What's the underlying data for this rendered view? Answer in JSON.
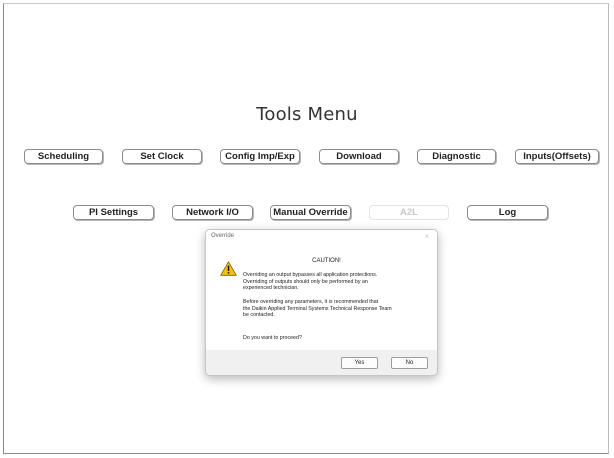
{
  "page": {
    "title": "Tools Menu"
  },
  "buttons_row1": [
    {
      "label": "Scheduling"
    },
    {
      "label": "Set Clock"
    },
    {
      "label": "Config Imp/Exp"
    },
    {
      "label": "Download"
    },
    {
      "label": "Diagnostic"
    },
    {
      "label": "Inputs(Offsets)"
    }
  ],
  "buttons_row2": [
    {
      "label": "PI Settings"
    },
    {
      "label": "Network I/O"
    },
    {
      "label": "Manual Override"
    },
    {
      "label": "A2L",
      "disabled": true
    },
    {
      "label": "Log"
    }
  ],
  "dialog": {
    "title": "Override",
    "close_glyph": "×",
    "icon": "warning-icon",
    "heading": "CAUTION!",
    "paragraph1_line1": "Overriding an output bypasses all application protections.",
    "paragraph1_line2": "Overriding of outputs should only be performed by an",
    "paragraph1_line3": "experienced technician.",
    "paragraph2_line1": "Before overriding any parameters, it is recommended that",
    "paragraph2_line2": "the Daikin Applied Terminal Systems Technical Response Team",
    "paragraph2_line3": "be contacted.",
    "question": "Do you want to proceed?",
    "yes_label": "Yes",
    "no_label": "No"
  },
  "colors": {
    "warning_fill": "#f5c400",
    "warning_stroke": "#7a6000",
    "button_border": "#8c8c8c",
    "disabled_text": "#c9c9c9"
  }
}
